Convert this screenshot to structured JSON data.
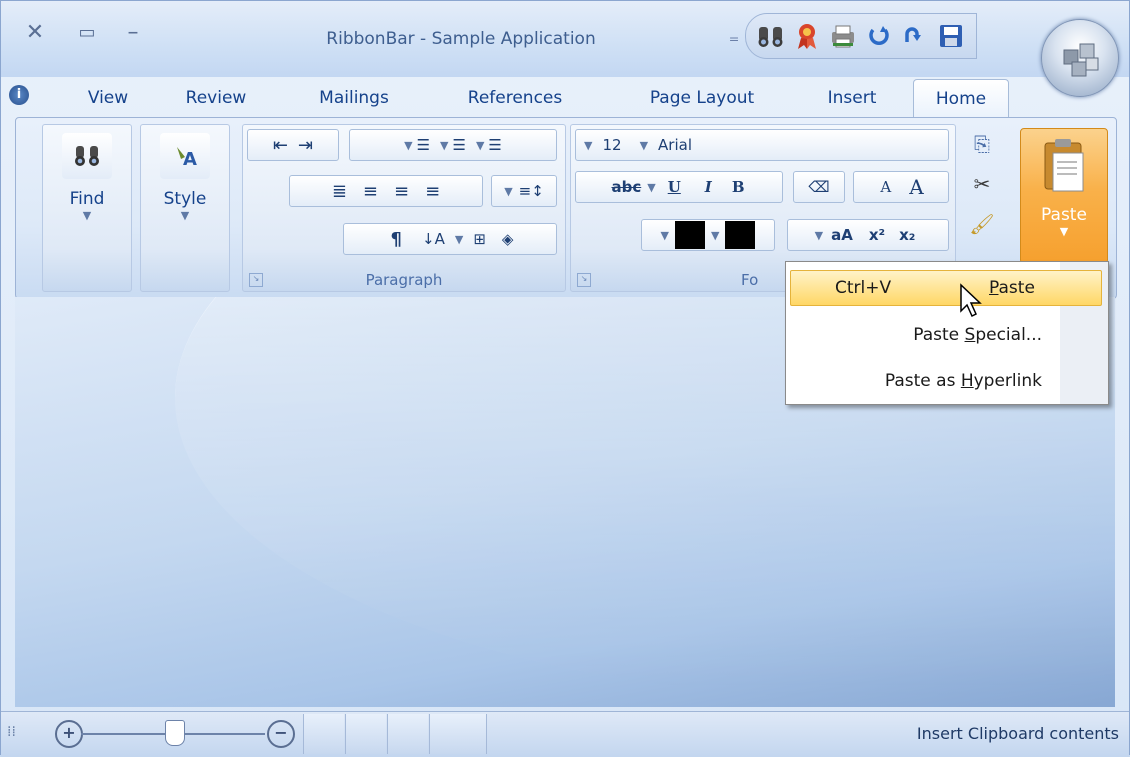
{
  "window": {
    "title": "RibbonBar - Sample Application"
  },
  "tabs": [
    {
      "label": "View"
    },
    {
      "label": "Review"
    },
    {
      "label": "Mailings"
    },
    {
      "label": "References"
    },
    {
      "label": "Page Layout"
    },
    {
      "label": "Insert"
    },
    {
      "label": "Home"
    }
  ],
  "active_tab": "Home",
  "ribbon": {
    "find_label": "Find",
    "style_label": "Style",
    "paragraph_label": "Paragraph",
    "font_group_label": "Fo",
    "font_size": "12",
    "font_name": "Arial",
    "paste_label": "Paste"
  },
  "paste_menu": {
    "item1_shortcut": "Ctrl+V",
    "item1_pre": "",
    "item1_key": "P",
    "item1_post": "aste",
    "item2_pre": "Paste ",
    "item2_key": "S",
    "item2_post": "pecial...",
    "item3_pre": "Paste as ",
    "item3_key": "H",
    "item3_post": "yperlink"
  },
  "status": {
    "text": "Insert Clipboard contents"
  },
  "colors": {
    "accent": "#15428b",
    "highlight": "#ffd766",
    "paste_active": "#fbb24a"
  },
  "icons": [
    "close-icon",
    "maximize-icon",
    "minimize-icon",
    "find-icon",
    "ribbon-icon",
    "print-icon",
    "undo-icon",
    "redo-icon",
    "save-icon",
    "app-orb-icon",
    "info-icon",
    "zoom-in-icon",
    "zoom-out-icon",
    "cursor-icon"
  ]
}
